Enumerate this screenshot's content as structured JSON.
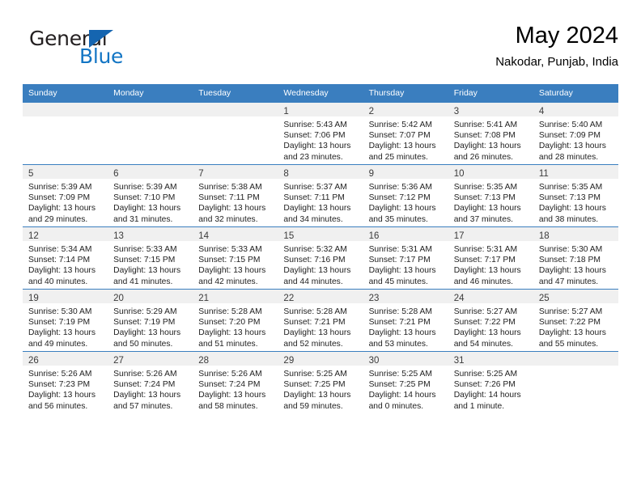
{
  "brand": {
    "name_part1": "General",
    "name_part2": "Blue",
    "triangle_icon": "triangle-icon",
    "color_dark": "#231f20",
    "color_blue": "#1275c4"
  },
  "header": {
    "title": "May 2024",
    "subtitle": "Nakodar, Punjab, India"
  },
  "theme": {
    "header_bg": "#3a7ebf",
    "daynum_bg": "#f0f0f0",
    "text": "#222222"
  },
  "weekday_headers": [
    "Sunday",
    "Monday",
    "Tuesday",
    "Wednesday",
    "Thursday",
    "Friday",
    "Saturday"
  ],
  "weeks": [
    [
      {
        "day": "",
        "lines": []
      },
      {
        "day": "",
        "lines": []
      },
      {
        "day": "",
        "lines": []
      },
      {
        "day": "1",
        "lines": [
          "Sunrise: 5:43 AM",
          "Sunset: 7:06 PM",
          "Daylight: 13 hours",
          "and 23 minutes."
        ]
      },
      {
        "day": "2",
        "lines": [
          "Sunrise: 5:42 AM",
          "Sunset: 7:07 PM",
          "Daylight: 13 hours",
          "and 25 minutes."
        ]
      },
      {
        "day": "3",
        "lines": [
          "Sunrise: 5:41 AM",
          "Sunset: 7:08 PM",
          "Daylight: 13 hours",
          "and 26 minutes."
        ]
      },
      {
        "day": "4",
        "lines": [
          "Sunrise: 5:40 AM",
          "Sunset: 7:09 PM",
          "Daylight: 13 hours",
          "and 28 minutes."
        ]
      }
    ],
    [
      {
        "day": "5",
        "lines": [
          "Sunrise: 5:39 AM",
          "Sunset: 7:09 PM",
          "Daylight: 13 hours",
          "and 29 minutes."
        ]
      },
      {
        "day": "6",
        "lines": [
          "Sunrise: 5:39 AM",
          "Sunset: 7:10 PM",
          "Daylight: 13 hours",
          "and 31 minutes."
        ]
      },
      {
        "day": "7",
        "lines": [
          "Sunrise: 5:38 AM",
          "Sunset: 7:11 PM",
          "Daylight: 13 hours",
          "and 32 minutes."
        ]
      },
      {
        "day": "8",
        "lines": [
          "Sunrise: 5:37 AM",
          "Sunset: 7:11 PM",
          "Daylight: 13 hours",
          "and 34 minutes."
        ]
      },
      {
        "day": "9",
        "lines": [
          "Sunrise: 5:36 AM",
          "Sunset: 7:12 PM",
          "Daylight: 13 hours",
          "and 35 minutes."
        ]
      },
      {
        "day": "10",
        "lines": [
          "Sunrise: 5:35 AM",
          "Sunset: 7:13 PM",
          "Daylight: 13 hours",
          "and 37 minutes."
        ]
      },
      {
        "day": "11",
        "lines": [
          "Sunrise: 5:35 AM",
          "Sunset: 7:13 PM",
          "Daylight: 13 hours",
          "and 38 minutes."
        ]
      }
    ],
    [
      {
        "day": "12",
        "lines": [
          "Sunrise: 5:34 AM",
          "Sunset: 7:14 PM",
          "Daylight: 13 hours",
          "and 40 minutes."
        ]
      },
      {
        "day": "13",
        "lines": [
          "Sunrise: 5:33 AM",
          "Sunset: 7:15 PM",
          "Daylight: 13 hours",
          "and 41 minutes."
        ]
      },
      {
        "day": "14",
        "lines": [
          "Sunrise: 5:33 AM",
          "Sunset: 7:15 PM",
          "Daylight: 13 hours",
          "and 42 minutes."
        ]
      },
      {
        "day": "15",
        "lines": [
          "Sunrise: 5:32 AM",
          "Sunset: 7:16 PM",
          "Daylight: 13 hours",
          "and 44 minutes."
        ]
      },
      {
        "day": "16",
        "lines": [
          "Sunrise: 5:31 AM",
          "Sunset: 7:17 PM",
          "Daylight: 13 hours",
          "and 45 minutes."
        ]
      },
      {
        "day": "17",
        "lines": [
          "Sunrise: 5:31 AM",
          "Sunset: 7:17 PM",
          "Daylight: 13 hours",
          "and 46 minutes."
        ]
      },
      {
        "day": "18",
        "lines": [
          "Sunrise: 5:30 AM",
          "Sunset: 7:18 PM",
          "Daylight: 13 hours",
          "and 47 minutes."
        ]
      }
    ],
    [
      {
        "day": "19",
        "lines": [
          "Sunrise: 5:30 AM",
          "Sunset: 7:19 PM",
          "Daylight: 13 hours",
          "and 49 minutes."
        ]
      },
      {
        "day": "20",
        "lines": [
          "Sunrise: 5:29 AM",
          "Sunset: 7:19 PM",
          "Daylight: 13 hours",
          "and 50 minutes."
        ]
      },
      {
        "day": "21",
        "lines": [
          "Sunrise: 5:28 AM",
          "Sunset: 7:20 PM",
          "Daylight: 13 hours",
          "and 51 minutes."
        ]
      },
      {
        "day": "22",
        "lines": [
          "Sunrise: 5:28 AM",
          "Sunset: 7:21 PM",
          "Daylight: 13 hours",
          "and 52 minutes."
        ]
      },
      {
        "day": "23",
        "lines": [
          "Sunrise: 5:28 AM",
          "Sunset: 7:21 PM",
          "Daylight: 13 hours",
          "and 53 minutes."
        ]
      },
      {
        "day": "24",
        "lines": [
          "Sunrise: 5:27 AM",
          "Sunset: 7:22 PM",
          "Daylight: 13 hours",
          "and 54 minutes."
        ]
      },
      {
        "day": "25",
        "lines": [
          "Sunrise: 5:27 AM",
          "Sunset: 7:22 PM",
          "Daylight: 13 hours",
          "and 55 minutes."
        ]
      }
    ],
    [
      {
        "day": "26",
        "lines": [
          "Sunrise: 5:26 AM",
          "Sunset: 7:23 PM",
          "Daylight: 13 hours",
          "and 56 minutes."
        ]
      },
      {
        "day": "27",
        "lines": [
          "Sunrise: 5:26 AM",
          "Sunset: 7:24 PM",
          "Daylight: 13 hours",
          "and 57 minutes."
        ]
      },
      {
        "day": "28",
        "lines": [
          "Sunrise: 5:26 AM",
          "Sunset: 7:24 PM",
          "Daylight: 13 hours",
          "and 58 minutes."
        ]
      },
      {
        "day": "29",
        "lines": [
          "Sunrise: 5:25 AM",
          "Sunset: 7:25 PM",
          "Daylight: 13 hours",
          "and 59 minutes."
        ]
      },
      {
        "day": "30",
        "lines": [
          "Sunrise: 5:25 AM",
          "Sunset: 7:25 PM",
          "Daylight: 14 hours",
          "and 0 minutes."
        ]
      },
      {
        "day": "31",
        "lines": [
          "Sunrise: 5:25 AM",
          "Sunset: 7:26 PM",
          "Daylight: 14 hours",
          "and 1 minute."
        ]
      },
      {
        "day": "",
        "lines": []
      }
    ]
  ]
}
